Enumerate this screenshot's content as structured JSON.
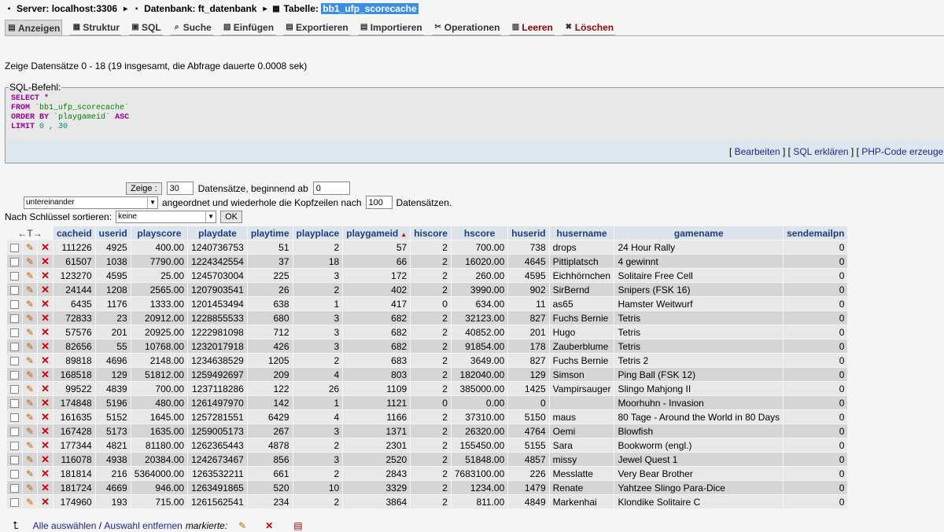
{
  "breadcrumb": {
    "server": "Server: localhost:3306",
    "database": "Datenbank: ft_datenbank",
    "table_prefix": "Tabelle:",
    "table_name": "bb1_ufp_scorecache"
  },
  "tabs": [
    {
      "label": "Anzeigen",
      "icon": "browse-icon",
      "glyph": "▤",
      "active": true
    },
    {
      "label": "Struktur",
      "icon": "structure-icon",
      "glyph": "▦"
    },
    {
      "label": "SQL",
      "icon": "sql-icon",
      "glyph": "▣"
    },
    {
      "label": "Suche",
      "icon": "search-icon",
      "glyph": "⌕"
    },
    {
      "label": "Einfügen",
      "icon": "insert-icon",
      "glyph": "▧"
    },
    {
      "label": "Exportieren",
      "icon": "export-icon",
      "glyph": "▤"
    },
    {
      "label": "Importieren",
      "icon": "import-icon",
      "glyph": "▤"
    },
    {
      "label": "Operationen",
      "icon": "operations-icon",
      "glyph": "✂"
    },
    {
      "label": "Leeren",
      "icon": "empty-icon",
      "glyph": "▥",
      "danger": true
    },
    {
      "label": "Löschen",
      "icon": "drop-icon",
      "glyph": "✖",
      "danger": true
    }
  ],
  "status": "Zeige Datensätze 0 - 18 (19 insgesamt, die Abfrage dauerte 0.0008 sek)",
  "sql": {
    "legend": "SQL-Befehl:",
    "select_kw": "SELECT",
    "star": "*",
    "from_kw": "FROM",
    "table": "`bb1_ufp_scorecache`",
    "order_kw": "ORDER BY",
    "order_col": "`playgameid`",
    "asc_kw": "ASC",
    "limit_kw": "LIMIT",
    "limit_val": "0 , 30"
  },
  "sql_links": {
    "edit": "Bearbeiten",
    "explain": "SQL erklären",
    "php": "PHP-Code erzeugen"
  },
  "nav": {
    "show_button": "Zeige :",
    "rows_value": "30",
    "rows_label": "Datensätze, beginnend ab",
    "start_value": "0",
    "mode_value": "untereinander",
    "repeat_label": "angeordnet und wiederhole die Kopfzeilen nach",
    "repeat_value": "100",
    "repeat_suffix": "Datensätzen.",
    "sort_label": "Nach Schlüssel sortieren:",
    "sort_value": "keine",
    "ok_button": "OK"
  },
  "table": {
    "control_header": "←T→",
    "columns": [
      "cacheid",
      "userid",
      "playscore",
      "playdate",
      "playtime",
      "playplace",
      "playgameid",
      "hiscore",
      "hscore",
      "huserid",
      "husername",
      "gamename",
      "sendemailpn"
    ],
    "sorted_column": "playgameid",
    "rows": [
      [
        "111226",
        "4925",
        "400.00",
        "1240736753",
        "51",
        "2",
        "57",
        "2",
        "700.00",
        "738",
        "drops",
        "24 Hour Rally",
        "0"
      ],
      [
        "61507",
        "1038",
        "7790.00",
        "1224342554",
        "37",
        "18",
        "66",
        "2",
        "16020.00",
        "4645",
        "Pittiplatsch",
        "4 gewinnt",
        "0"
      ],
      [
        "123270",
        "4595",
        "25.00",
        "1245703004",
        "225",
        "3",
        "172",
        "2",
        "260.00",
        "4595",
        "Eichhörnchen",
        "Solitaire Free Cell",
        "0"
      ],
      [
        "24144",
        "1208",
        "2565.00",
        "1207903541",
        "26",
        "2",
        "402",
        "2",
        "3990.00",
        "902",
        "SirBernd",
        "Snipers (FSK 16)",
        "0"
      ],
      [
        "6435",
        "1176",
        "1333.00",
        "1201453494",
        "638",
        "1",
        "417",
        "0",
        "634.00",
        "11",
        "as65",
        "Hamster Weitwurf",
        "0"
      ],
      [
        "72833",
        "23",
        "20912.00",
        "1228855533",
        "680",
        "3",
        "682",
        "2",
        "32123.00",
        "827",
        "Fuchs Bernie",
        "Tetris",
        "0"
      ],
      [
        "57576",
        "201",
        "20925.00",
        "1222981098",
        "712",
        "3",
        "682",
        "2",
        "40852.00",
        "201",
        "Hugo",
        "Tetris",
        "0"
      ],
      [
        "82656",
        "55",
        "10768.00",
        "1232017918",
        "426",
        "3",
        "682",
        "2",
        "91854.00",
        "178",
        "Zauberblume",
        "Tetris",
        "0"
      ],
      [
        "89818",
        "4696",
        "2148.00",
        "1234638529",
        "1205",
        "2",
        "683",
        "2",
        "3649.00",
        "827",
        "Fuchs Bernie",
        "Tetris 2",
        "0"
      ],
      [
        "168518",
        "129",
        "51812.00",
        "1259492697",
        "209",
        "4",
        "803",
        "2",
        "182040.00",
        "129",
        "Simson",
        "Ping Ball  (FSK 12)",
        "0"
      ],
      [
        "99522",
        "4839",
        "700.00",
        "1237118286",
        "122",
        "26",
        "1109",
        "2",
        "385000.00",
        "1425",
        "Vampirsauger",
        "Slingo Mahjong II",
        "0"
      ],
      [
        "174848",
        "5196",
        "480.00",
        "1261497970",
        "142",
        "1",
        "1121",
        "0",
        "0.00",
        "0",
        "",
        "Moorhuhn - Invasion",
        "0"
      ],
      [
        "161635",
        "5152",
        "1645.00",
        "1257281551",
        "6429",
        "4",
        "1166",
        "2",
        "37310.00",
        "5150",
        "maus",
        "80 Tage - Around the World in 80 Days",
        "0"
      ],
      [
        "167428",
        "5173",
        "1635.00",
        "1259005173",
        "267",
        "3",
        "1371",
        "2",
        "26320.00",
        "4764",
        "Oemi",
        "Blowfish",
        "0"
      ],
      [
        "177344",
        "4821",
        "81180.00",
        "1262365443",
        "4878",
        "2",
        "2301",
        "2",
        "155450.00",
        "5155",
        "Sara",
        "Bookworm (engl.)",
        "0"
      ],
      [
        "116078",
        "4938",
        "20384.00",
        "1242673467",
        "856",
        "3",
        "2520",
        "2",
        "51848.00",
        "4857",
        "missy",
        "Jewel Quest 1",
        "0"
      ],
      [
        "181814",
        "216",
        "5364000.00",
        "1263532211",
        "661",
        "2",
        "2843",
        "2",
        "7683100.00",
        "226",
        "Messlatte",
        "Very Bear Brother",
        "0"
      ],
      [
        "181724",
        "4669",
        "946.00",
        "1263491865",
        "520",
        "10",
        "3329",
        "2",
        "1234.00",
        "1479",
        "Renate",
        "Yahtzee Slingo Para-Dice",
        "0"
      ],
      [
        "174960",
        "193",
        "715.00",
        "1261562541",
        "234",
        "2",
        "3864",
        "2",
        "811.00",
        "4849",
        "Markenhai",
        "Klondike Solitaire C",
        "0"
      ]
    ]
  },
  "footer": {
    "select_all": "Alle auswählen",
    "separator": " / ",
    "deselect_all": "Auswahl entfernen",
    "marked_label": "markierte:"
  }
}
